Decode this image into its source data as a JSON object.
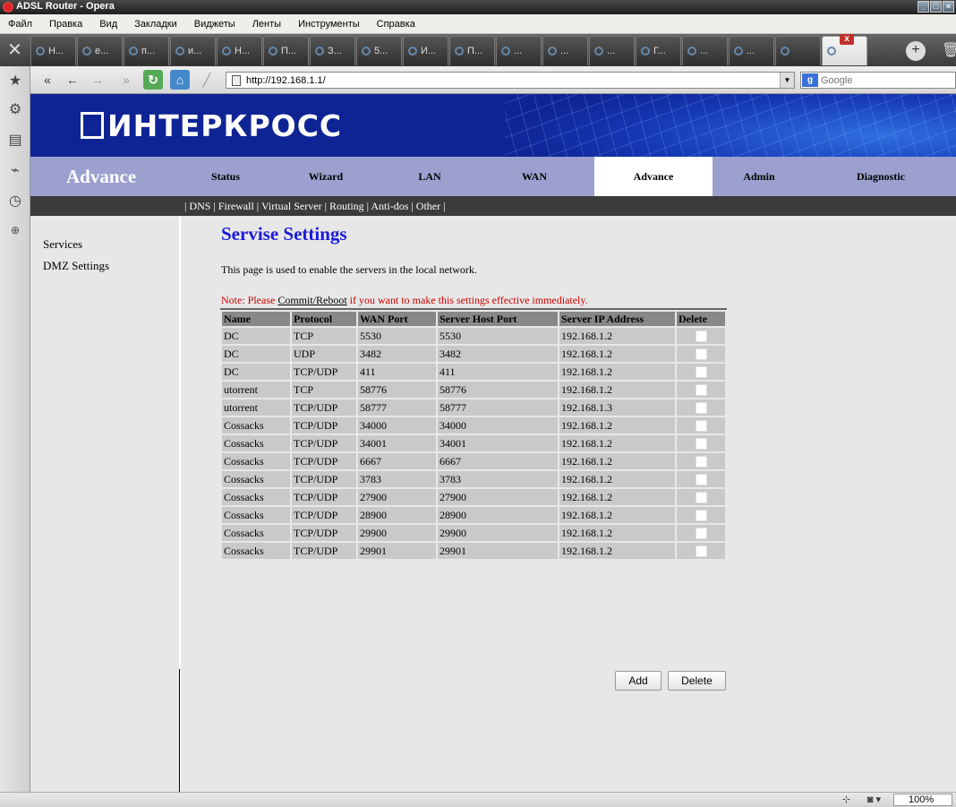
{
  "window": {
    "title": "ADSL Router - Opera"
  },
  "menu": [
    "Файл",
    "Правка",
    "Вид",
    "Закладки",
    "Виджеты",
    "Ленты",
    "Инструменты",
    "Справка"
  ],
  "tabs": [
    "Н...",
    "e...",
    "п...",
    "и...",
    "Н...",
    "П...",
    "З...",
    "5...",
    "И...",
    "П...",
    "...",
    "...",
    "...",
    "Г...",
    "...",
    "...",
    "",
    ""
  ],
  "address": {
    "url": "http://192.168.1.1/",
    "search_placeholder": "Google"
  },
  "brand": {
    "logo": "ИНТЕРКРОСС"
  },
  "nav": {
    "section": "Advance",
    "items": [
      "Status",
      "Wizard",
      "LAN",
      "WAN",
      "Advance",
      "Admin",
      "Diagnostic"
    ],
    "active": "Advance"
  },
  "subnav": "| DNS | Firewall | Virtual Server | Routing | Anti-dos | Other |",
  "sidebar": [
    "Services",
    "DMZ Settings"
  ],
  "content": {
    "title": "Servise Settings",
    "description": "This page is used to enable the servers in the local network.",
    "note_prefix": "Note: Please ",
    "note_link": "Commit/Reboot",
    "note_suffix": " if you want to make this settings effective immediately."
  },
  "table": {
    "headers": [
      "Name",
      "Protocol",
      "WAN Port",
      "Server Host Port",
      "Server IP Address",
      "Delete"
    ],
    "rows": [
      [
        "DC",
        "TCP",
        "5530",
        "5530",
        "192.168.1.2"
      ],
      [
        "DC",
        "UDP",
        "3482",
        "3482",
        "192.168.1.2"
      ],
      [
        "DC",
        "TCP/UDP",
        "411",
        "411",
        "192.168.1.2"
      ],
      [
        "utorrent",
        "TCP",
        "58776",
        "58776",
        "192.168.1.2"
      ],
      [
        "utorrent",
        "TCP/UDP",
        "58777",
        "58777",
        "192.168.1.3"
      ],
      [
        "Cossacks",
        "TCP/UDP",
        "34000",
        "34000",
        "192.168.1.2"
      ],
      [
        "Cossacks",
        "TCP/UDP",
        "34001",
        "34001",
        "192.168.1.2"
      ],
      [
        "Cossacks",
        "TCP/UDP",
        "6667",
        "6667",
        "192.168.1.2"
      ],
      [
        "Cossacks",
        "TCP/UDP",
        "3783",
        "3783",
        "192.168.1.2"
      ],
      [
        "Cossacks",
        "TCP/UDP",
        "27900",
        "27900",
        "192.168.1.2"
      ],
      [
        "Cossacks",
        "TCP/UDP",
        "28900",
        "28900",
        "192.168.1.2"
      ],
      [
        "Cossacks",
        "TCP/UDP",
        "29900",
        "29900",
        "192.168.1.2"
      ],
      [
        "Cossacks",
        "TCP/UDP",
        "29901",
        "29901",
        "192.168.1.2"
      ]
    ]
  },
  "buttons": {
    "add": "Add",
    "delete": "Delete"
  },
  "status": {
    "zoom": "100%"
  }
}
